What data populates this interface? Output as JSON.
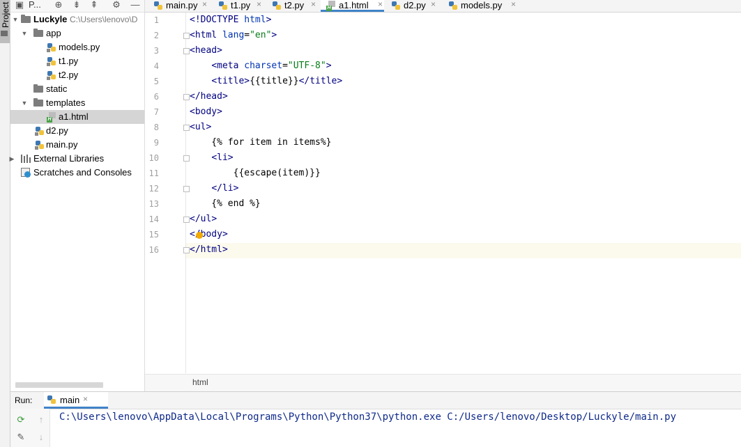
{
  "side_strip": {
    "project_label": "Project"
  },
  "project_panel": {
    "toolbar_title": "P...",
    "tree": [
      {
        "label": "Luckyle",
        "path": "C:\\Users\\lenovo\\D",
        "type": "folder",
        "expanded": true
      },
      {
        "label": "app",
        "type": "folder",
        "expanded": true
      },
      {
        "label": "models.py",
        "type": "python"
      },
      {
        "label": "t1.py",
        "type": "python"
      },
      {
        "label": "t2.py",
        "type": "python"
      },
      {
        "label": "static",
        "type": "folder"
      },
      {
        "label": "templates",
        "type": "folder",
        "expanded": true
      },
      {
        "label": "a1.html",
        "type": "html",
        "selected": true
      },
      {
        "label": "d2.py",
        "type": "python"
      },
      {
        "label": "main.py",
        "type": "python"
      },
      {
        "label": "External Libraries",
        "type": "library",
        "expanded": false
      },
      {
        "label": "Scratches and Consoles",
        "type": "scratch"
      }
    ]
  },
  "tabs": [
    {
      "label": "main.py",
      "icon": "python-icon",
      "active": false
    },
    {
      "label": "t1.py",
      "icon": "python-icon",
      "active": false
    },
    {
      "label": "t2.py",
      "icon": "python-icon",
      "active": false
    },
    {
      "label": "a1.html",
      "icon": "html-icon",
      "active": true
    },
    {
      "label": "d2.py",
      "icon": "python-icon",
      "active": false
    },
    {
      "label": "models.py",
      "icon": "python-icon",
      "active": false
    }
  ],
  "editor": {
    "line_numbers": [
      "1",
      "2",
      "3",
      "4",
      "5",
      "6",
      "7",
      "8",
      "9",
      "10",
      "11",
      "12",
      "13",
      "14",
      "15",
      "16"
    ],
    "lines": [
      "<!DOCTYPE html>",
      "<html lang=\"en\">",
      "<head>",
      "    <meta charset=\"UTF-8\">",
      "    <title>{{title}}</title>",
      "</head>",
      "<body>",
      "<ul>",
      "    {% for item in items%}",
      "    <li>",
      "        {{escape(item)}}",
      "    </li>",
      "    {% end %}",
      "</ul>",
      "</body>",
      "</html>"
    ],
    "current_line": 16
  },
  "breadcrumb": {
    "text": "html"
  },
  "run_panel": {
    "title": "Run:",
    "tab_label": "main",
    "output": "C:\\Users\\lenovo\\AppData\\Local\\Programs\\Python\\Python37\\python.exe C:/Users/lenovo/Desktop/Luckyle/main.py"
  },
  "colors": {
    "accent": "#4083c9",
    "tag": "#000080",
    "attribute": "#0033b3",
    "string": "#067d17",
    "run_output": "#0f2a8a"
  }
}
